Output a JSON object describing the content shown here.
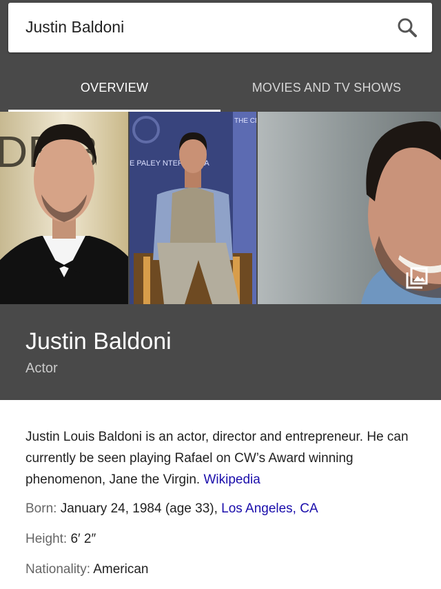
{
  "search": {
    "query": "Justin Baldoni"
  },
  "tabs": [
    {
      "label": "OVERVIEW",
      "active": true
    },
    {
      "label": "MOVIES AND TV SHOWS",
      "active": false
    }
  ],
  "entity": {
    "name": "Justin Baldoni",
    "type": "Actor",
    "description": "Justin Louis Baldoni is an actor, director and entrepreneur. He can currently be seen playing Rafael on CW’s Award winning phenomenon, Jane the Virgin.",
    "source_link": "Wikipedia",
    "facts": {
      "born": {
        "label": "Born:",
        "value": "January 24, 1984 (age 33),",
        "link": "Los Angeles, CA"
      },
      "height": {
        "label": "Height:",
        "value": "6′ 2″"
      },
      "nationality": {
        "label": "Nationality:",
        "value": "American"
      }
    }
  },
  "gallery": {
    "photo1_backdrop_text": "DE B",
    "photo2_backdrop_text": "E PALEY NTER MEDIA",
    "photo2_sign_text": "THE CEN FOR"
  },
  "colors": {
    "header_bg": "#494949",
    "link": "#1a0dab",
    "accent_underline": "#ffffff"
  }
}
